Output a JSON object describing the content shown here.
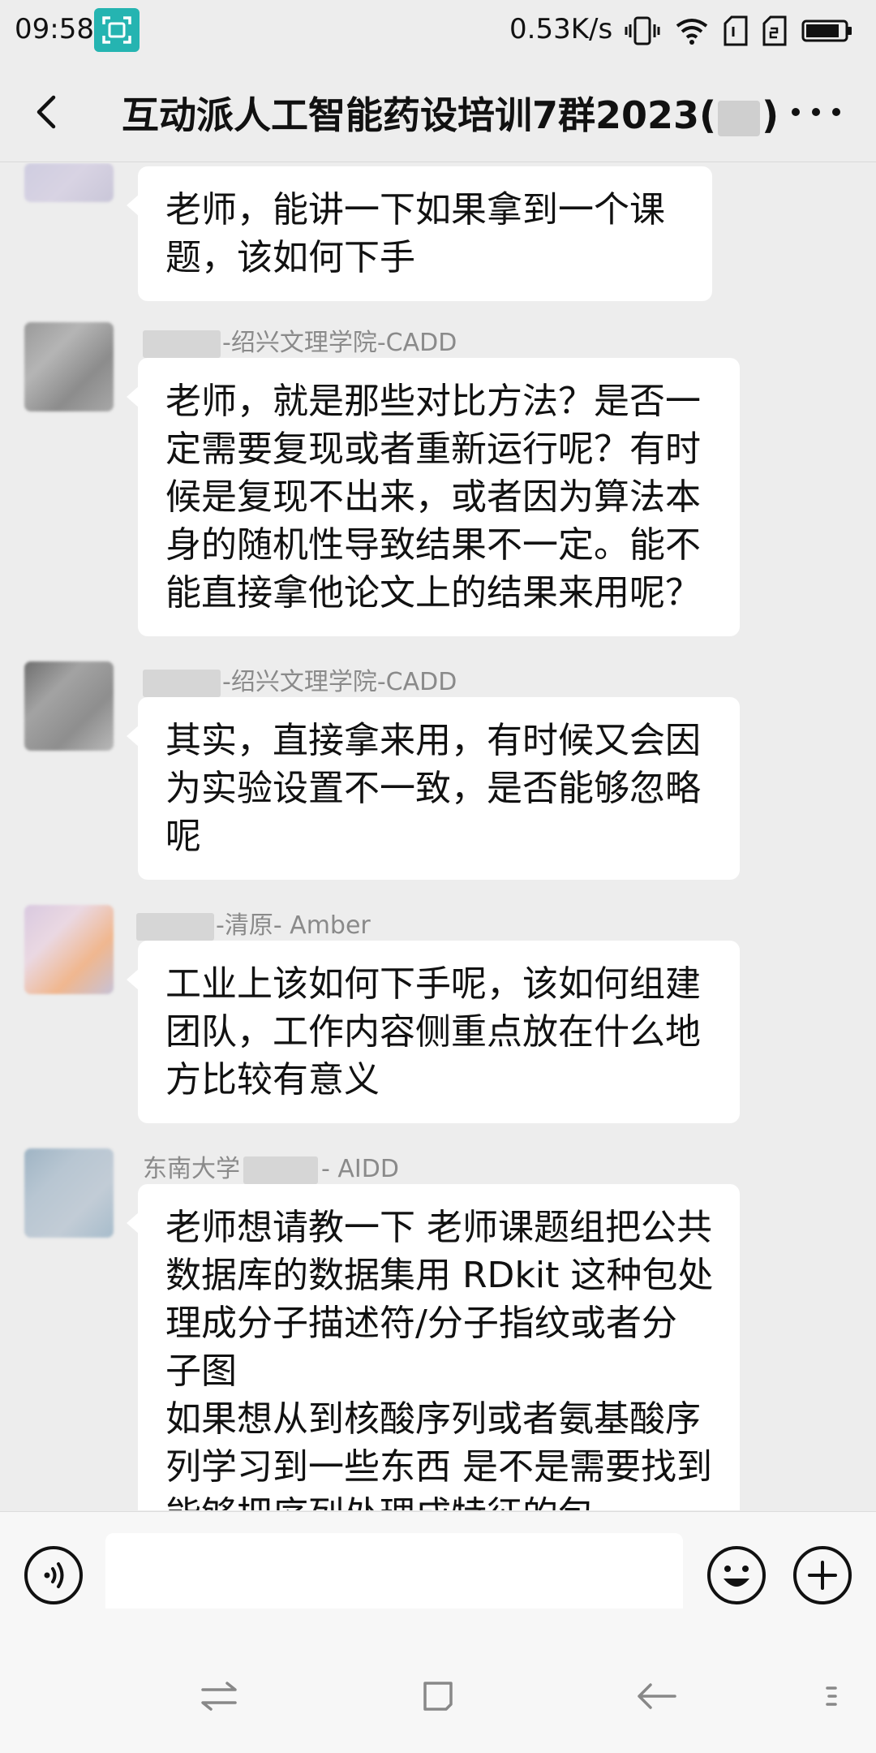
{
  "status_bar": {
    "time": "09:58",
    "network_speed": "0.53K/s",
    "icons": [
      "scan-icon",
      "vibrate-icon",
      "wifi-icon",
      "sim1-icon",
      "sim2-icon",
      "battery-icon"
    ]
  },
  "header": {
    "title_prefix": "互动派人工智能药设培训7群2023(",
    "title_suffix": ")",
    "icons": [
      "back-arrow-icon",
      "more-dots-icon"
    ]
  },
  "messages": [
    {
      "sender": "",
      "text": "老师，能讲一下如果拿到一个课\n题，该如何下手"
    },
    {
      "sender": "-绍兴文理学院-CADD",
      "text": "老师，就是那些对比方法？是否一\n定需要复现或者重新运行呢？有时\n候是复现不出来，或者因为算法本\n身的随机性导致结果不一定。能不\n能直接拿他论文上的结果来用呢？"
    },
    {
      "sender": "-绍兴文理学院-CADD",
      "text": "其实，直接拿来用，有时候又会因\n为实验设置不一致，是否能够忽略\n呢"
    },
    {
      "sender": "-清原- Amber",
      "text": "工业上该如何下手呢，该如何组建\n团队，工作内容侧重点放在什么地\n方比较有意义"
    },
    {
      "sender_prefix": "东南大学",
      "sender_suffix": "- AIDD",
      "text": "老师想请教一下 老师课题组把公共\n数据库的数据集用 RDkit 这种包处\n理成分子描述符/分子指纹或者分\n子图\n如果想从到核酸序列或者氨基酸序\n列学习到一些东西 是不是需要找到\n能够把序列处理成特征的包"
    }
  ],
  "input_bar": {
    "placeholder": "",
    "icons": [
      "voice-icon",
      "emoji-icon",
      "plus-icon"
    ]
  },
  "nav_bar": {
    "icons": [
      "switch-icon",
      "home-square-icon",
      "back-nav-icon",
      "menu-icon"
    ]
  },
  "colors": {
    "background": "#ededed",
    "bubble": "#ffffff",
    "sender_name": "#8a8a8a",
    "scan_badge": "#25b4b1"
  }
}
